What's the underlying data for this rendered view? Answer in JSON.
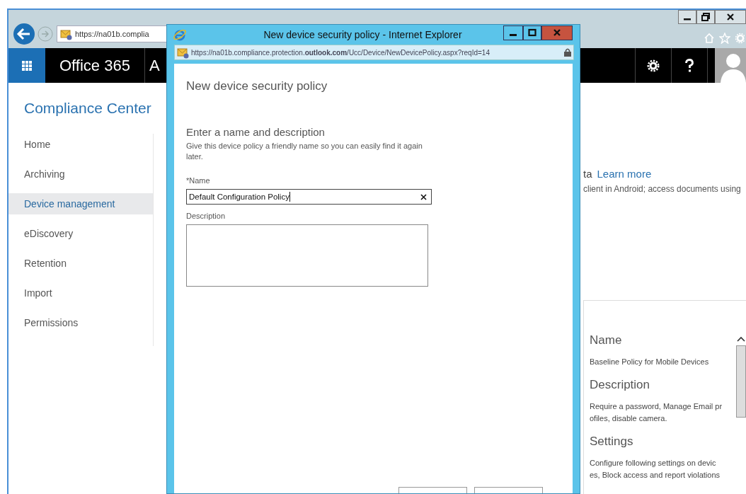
{
  "browser": {
    "address": "https://na01b.complia"
  },
  "suite_bar": {
    "app_name": "Office 365",
    "cut_label": "A"
  },
  "sidebar": {
    "title": "Compliance Center",
    "items": [
      {
        "label": "Home",
        "selected": false
      },
      {
        "label": "Archiving",
        "selected": false
      },
      {
        "label": "Device management",
        "selected": true
      },
      {
        "label": "eDiscovery",
        "selected": false
      },
      {
        "label": "Retention",
        "selected": false
      },
      {
        "label": "Import",
        "selected": false
      },
      {
        "label": "Permissions",
        "selected": false
      }
    ]
  },
  "page": {
    "fragment": "ta",
    "learn_more": "Learn more",
    "line": "client in Android; access documents using"
  },
  "details_panel": {
    "sections": [
      {
        "heading": "Name",
        "lines": [
          "Baseline Policy for Mobile Devices"
        ]
      },
      {
        "heading": "Description",
        "lines": [
          "Require a password, Manage Email pr",
          "ofiles, disable camera."
        ]
      },
      {
        "heading": "Settings",
        "lines": [
          "Configure following settings on devic",
          "es, Block access and report violations"
        ]
      }
    ]
  },
  "popup": {
    "title": "New device security policy - Internet Explorer",
    "address": "https://na01b.compliance.protection.**outlook.com**/Ucc/Device/NewDevicePolicy.aspx?reqId=14",
    "heading": "New device security policy",
    "section_title": "Enter a name and description",
    "help": "Give this device policy a friendly name so you can easily find it again later.",
    "fields": [
      {
        "kind": "text",
        "label": "*Name",
        "value": "Default Configuration Policy"
      },
      {
        "kind": "textarea",
        "label": "Description"
      }
    ],
    "footer_buttons": [
      {
        "kind": "button"
      },
      {
        "kind": "button"
      }
    ]
  }
}
